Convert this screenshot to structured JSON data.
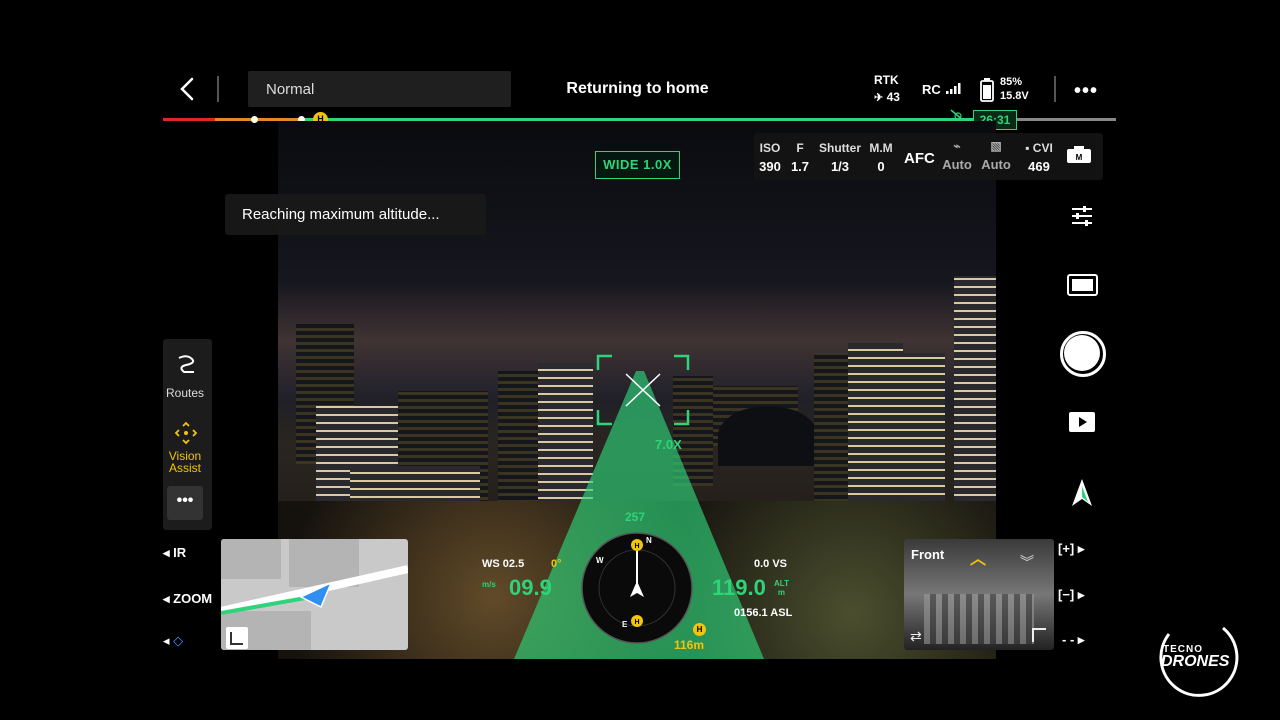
{
  "top_bar": {
    "flight_mode": "Normal",
    "status_title": "Returning to home",
    "rtk_label": "RTK",
    "rtk_value": "43",
    "rc_label": "RC",
    "battery_percent": "85%",
    "battery_voltage": "15.8V",
    "remaining_time": "26:31",
    "home_marker": "H"
  },
  "lens_badge": "WIDE 1.0X",
  "notification": "Reaching maximum altitude...",
  "camera_params": {
    "iso_label": "ISO",
    "iso_value": "390",
    "f_label": "F",
    "f_value": "1.7",
    "shutter_label": "Shutter",
    "shutter_value": "1/3",
    "mm_label": "M.M",
    "mm_value": "0",
    "focus_mode": "AFC",
    "auto1": "Auto",
    "auto2": "Auto",
    "storage_label": "CVI",
    "storage_value": "469"
  },
  "left_panel": {
    "routes_label": "Routes",
    "vision_label": "Vision Assist",
    "more_label": "•••",
    "ir_label": "IR",
    "zoom_label": "ZOOM"
  },
  "telemetry": {
    "wind_speed": "WS 02.5",
    "speed_unit": "m/s",
    "horizontal_speed": "09.9",
    "pitch": "0°",
    "heading": "257",
    "vertical_speed": "0.0  VS",
    "altitude": "119.0",
    "alt_label": "ALT",
    "alt_unit": "m",
    "asl": "0156.1 ASL",
    "home_distance": "116m",
    "compass_n": "N",
    "compass_e": "E",
    "compass_w": "W"
  },
  "zoom_overlay": "7.0X",
  "front_view": {
    "label": "Front"
  },
  "right_column": {
    "zoom_in": "[+]",
    "zoom_out": "[−]",
    "zoom_extra": "- -"
  },
  "logo": {
    "line1": "TECNO",
    "line2": "DRONES"
  },
  "colors": {
    "accent_green": "#2ed37a",
    "warning_yellow": "#f1c40f",
    "panel_bg": "#1c1c1c"
  }
}
